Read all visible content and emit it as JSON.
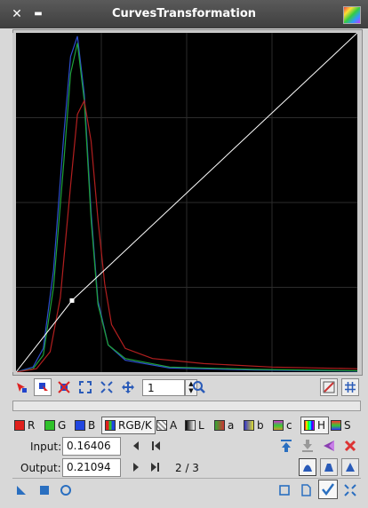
{
  "window": {
    "title": "CurvesTransformation"
  },
  "toolbar": {
    "zoom_value": "1"
  },
  "channels": [
    {
      "label": "R",
      "color": "#e0201c"
    },
    {
      "label": "G",
      "color": "#2fc22a"
    },
    {
      "label": "B",
      "color": "#2046e0"
    },
    {
      "label": "RGB/K",
      "color": "#ffffff",
      "selected": true
    },
    {
      "label": "A",
      "color": "#aaaaaa"
    },
    {
      "label": "L",
      "color": "#777777"
    },
    {
      "label": "a",
      "color": "#c43"
    },
    {
      "label": "b",
      "color": "#da2"
    },
    {
      "label": "c",
      "color": "#a5c"
    },
    {
      "label": "H",
      "color": "#aa44cc"
    },
    {
      "label": "S",
      "color": "#cc4488"
    }
  ],
  "point": {
    "input_label": "Input:",
    "input_value": "0.16406",
    "output_label": "Output:",
    "output_value": "0.21094",
    "index": "2 / 3"
  },
  "curve": {
    "points": [
      [
        0,
        0
      ],
      [
        0.16406,
        0.21094
      ],
      [
        1,
        1
      ]
    ]
  },
  "histogram": {
    "red": [
      [
        0,
        0
      ],
      [
        0.06,
        0.01
      ],
      [
        0.1,
        0.06
      ],
      [
        0.13,
        0.22
      ],
      [
        0.16,
        0.55
      ],
      [
        0.18,
        0.76
      ],
      [
        0.2,
        0.8
      ],
      [
        0.22,
        0.68
      ],
      [
        0.24,
        0.45
      ],
      [
        0.26,
        0.26
      ],
      [
        0.28,
        0.14
      ],
      [
        0.32,
        0.07
      ],
      [
        0.4,
        0.04
      ],
      [
        0.55,
        0.025
      ],
      [
        0.75,
        0.015
      ],
      [
        1,
        0.01
      ]
    ],
    "green": [
      [
        0,
        0
      ],
      [
        0.05,
        0.01
      ],
      [
        0.08,
        0.05
      ],
      [
        0.11,
        0.25
      ],
      [
        0.14,
        0.62
      ],
      [
        0.16,
        0.88
      ],
      [
        0.18,
        0.97
      ],
      [
        0.2,
        0.8
      ],
      [
        0.22,
        0.45
      ],
      [
        0.24,
        0.2
      ],
      [
        0.27,
        0.08
      ],
      [
        0.32,
        0.04
      ],
      [
        0.45,
        0.015
      ],
      [
        0.7,
        0.008
      ],
      [
        1,
        0.004
      ]
    ],
    "blue": [
      [
        0,
        0
      ],
      [
        0.05,
        0.015
      ],
      [
        0.08,
        0.07
      ],
      [
        0.11,
        0.3
      ],
      [
        0.14,
        0.7
      ],
      [
        0.16,
        0.93
      ],
      [
        0.18,
        0.99
      ],
      [
        0.2,
        0.82
      ],
      [
        0.22,
        0.47
      ],
      [
        0.24,
        0.21
      ],
      [
        0.27,
        0.08
      ],
      [
        0.32,
        0.035
      ],
      [
        0.45,
        0.012
      ],
      [
        0.7,
        0.006
      ],
      [
        1,
        0.003
      ]
    ]
  }
}
